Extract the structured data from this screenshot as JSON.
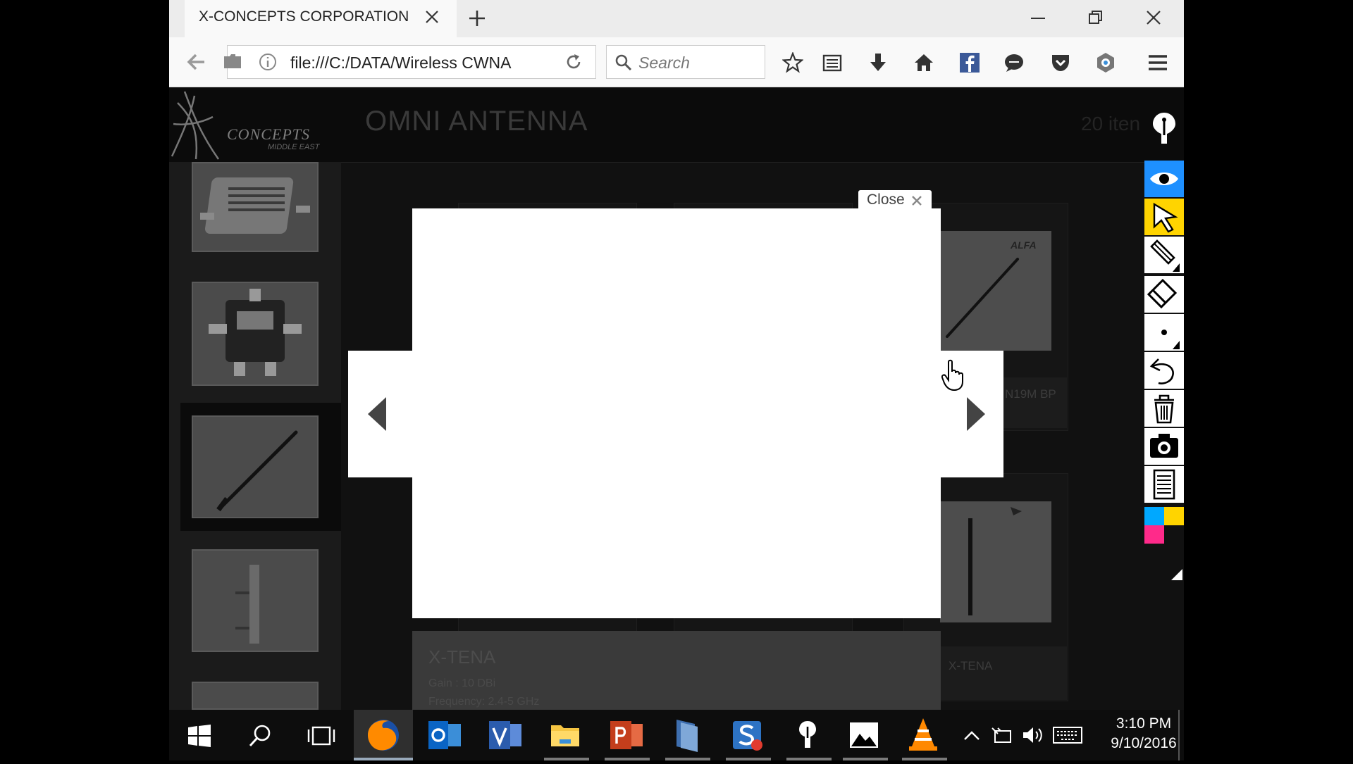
{
  "browser": {
    "tab_title": "X-CONCEPTS CORPORATION",
    "url": "file:///C:/DATA/Wireless CWNA",
    "search_placeholder": "Search"
  },
  "page": {
    "logo_text": "CONCEPTS",
    "logo_subtext": "MIDDLE EAST",
    "title": "OMNI ANTENNA",
    "item_count": "20 iten"
  },
  "grid": {
    "alfa_badge": "ALFA",
    "card1_label": "N19M BP",
    "card2_label": "X-TENA"
  },
  "lightbox": {
    "close_label": "Close",
    "caption_title": "X-TENA",
    "caption_line1": "Gain : 10 DBi",
    "caption_line2": "Frequency: 2.4-5 GHz"
  },
  "taskbar": {
    "time": "3:10 PM",
    "date": "9/10/2016"
  },
  "colors": {
    "accent_blue": "#1e90ff",
    "accent_yellow": "#ffd400",
    "accent_pink": "#ff2a8a",
    "accent_cyan": "#00a8ff"
  }
}
